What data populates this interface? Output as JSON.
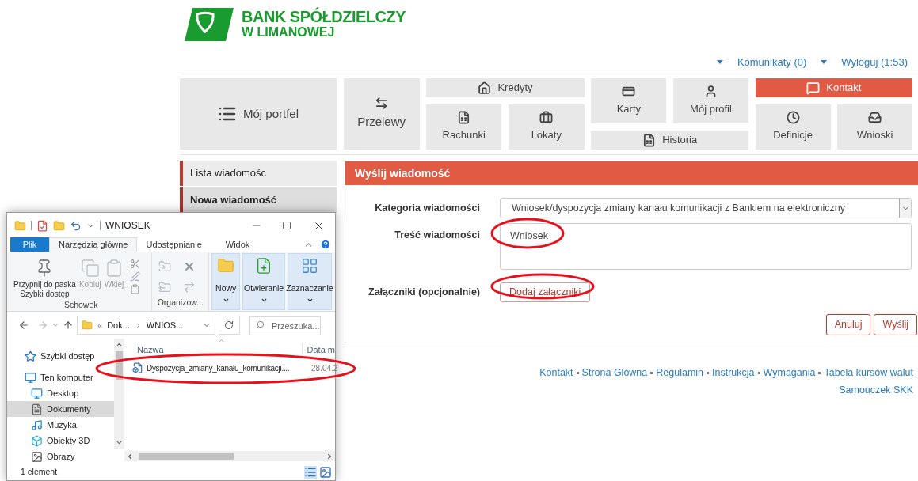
{
  "header": {
    "bank_name": "BANK SPÓŁDZIELCZY",
    "bank_city": "W LIMANOWEJ"
  },
  "top_links": [
    {
      "kind": "dropdown"
    },
    {
      "kind": "link",
      "label": "Komunikaty (0)"
    },
    {
      "kind": "dropdown"
    },
    {
      "kind": "link",
      "label": "Wyloguj (1:53)"
    }
  ],
  "nav": {
    "tiles": [
      {
        "label": "Mój portfel",
        "selected": false
      },
      {
        "label": "Przelewy",
        "selected": false
      },
      {
        "label": "Kredyty",
        "selected": false
      },
      {
        "label": "Rachunki",
        "selected": false
      },
      {
        "label": "Lokaty",
        "selected": false
      },
      {
        "label": "Karty",
        "selected": false
      },
      {
        "label": "Mój profil",
        "selected": false
      },
      {
        "label": "Historia",
        "selected": false
      },
      {
        "label": "Kontakt",
        "selected": true
      },
      {
        "label": "Definicje",
        "selected": false
      },
      {
        "label": "Wnioski",
        "selected": false
      }
    ]
  },
  "sidebar": {
    "items": [
      {
        "label": "Lista wiadomośc",
        "selected": false
      },
      {
        "label": "Nowa wiadomość",
        "selected": true
      }
    ]
  },
  "panel": {
    "title": "Wyślij wiadomość",
    "category": {
      "label": "Kategoria wiadomości",
      "value": "Wniosek/dyspozycja zmiany kanału komunikacji z Bankiem na elektroniczny"
    },
    "message": {
      "label": "Treść wiadomości",
      "value": "Wniosek"
    },
    "attachments": {
      "label": "Załączniki (opcjonalnie)",
      "button": "Dodaj załączniki"
    },
    "buttons": [
      "Anuluj",
      "Wyślij"
    ]
  },
  "footer": {
    "rows": [
      {
        "links": [
          "Kontakt",
          "Strona Główna",
          "Regulamin",
          "Instrukcja",
          "Wymagania",
          "Tabela kursów walut"
        ]
      },
      {
        "links": [
          "Samouczek SKK"
        ]
      }
    ]
  },
  "explorer": {
    "title": "WNIOSEK",
    "ribbon_tabs": [
      {
        "label": "Plik",
        "kind": "file",
        "selected": false
      },
      {
        "label": "Narzędzia główne",
        "kind": "tab",
        "selected": true
      },
      {
        "label": "Udostępnianie",
        "kind": "tab",
        "selected": false
      },
      {
        "label": "Widok",
        "kind": "tab",
        "selected": false
      }
    ],
    "clipboard": {
      "label": "Schowek",
      "buttons": [
        {
          "label": "Przypnij do paska\nSzybki dostęp",
          "disabled": false
        },
        {
          "label": "Kopiuj",
          "disabled": true
        },
        {
          "label": "Wklej",
          "disabled": true
        }
      ]
    },
    "organize": {
      "label": "Organizow..."
    },
    "large_buttons": [
      {
        "label": "Nowy"
      },
      {
        "label": "Otwieranie"
      },
      {
        "label": "Zaznaczanie"
      }
    ],
    "address_prefix": "«",
    "breadcrumbs": [
      "Dok...",
      "WNIOS..."
    ],
    "search": {
      "placeholder": "Przeszuka..."
    },
    "nav_pane": [
      {
        "label": "Szybki dostęp",
        "selected": false
      },
      {
        "label": "Ten komputer",
        "selected": false,
        "children": [
          {
            "label": "Desktop",
            "selected": false
          },
          {
            "label": "Dokumenty",
            "selected": true
          },
          {
            "label": "Muzyka",
            "selected": false
          },
          {
            "label": "Obiekty 3D",
            "selected": false
          },
          {
            "label": "Obrazy",
            "selected": false
          }
        ]
      }
    ],
    "columns": [
      "Nazwa",
      "Data m"
    ],
    "files": [
      {
        "name": "Dyspozycja_zmiany_kanału_komunikacji....",
        "date": "28.04.2"
      }
    ],
    "status": "1 element"
  }
}
